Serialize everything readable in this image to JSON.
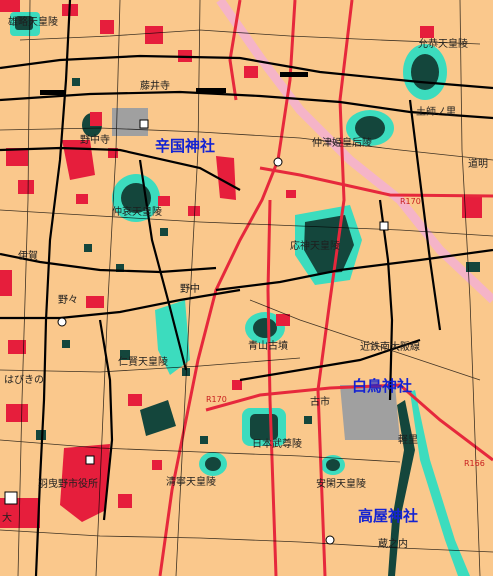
{
  "colors": {
    "land": "#fac88c",
    "road_red": "#e6283c",
    "road_black": "#000000",
    "block_red": "#e61e3c",
    "mound_green": "#14463c",
    "moat_cyan": "#3cdcbe",
    "grey_area": "#a0a0a0",
    "rail_pink": "#f5b4c8",
    "shrine_text": "#1423d2"
  },
  "shrines": [
    {
      "name": "辛国神社"
    },
    {
      "name": "白鳥神社"
    },
    {
      "name": "高屋神社"
    }
  ],
  "kofun": [
    {
      "name": "雄略天皇陵"
    },
    {
      "name": "允恭天皇陵"
    },
    {
      "name": "仲津姫皇后陵"
    },
    {
      "name": "仲哀天皇陵"
    },
    {
      "name": "応神天皇陵"
    },
    {
      "name": "野中寺"
    },
    {
      "name": "仁賢天皇陵"
    },
    {
      "name": "青山古墳"
    },
    {
      "name": "日本武尊陵"
    },
    {
      "name": "清寧天皇陵"
    },
    {
      "name": "安閑天皇陵"
    },
    {
      "name": "羽曳野市役所"
    }
  ],
  "places": [
    {
      "name": "藤井寺"
    },
    {
      "name": "土師ノ里"
    },
    {
      "name": "道明"
    },
    {
      "name": "伊賀"
    },
    {
      "name": "野々"
    },
    {
      "name": "野中"
    },
    {
      "name": "はびきの"
    },
    {
      "name": "古市"
    },
    {
      "name": "近鉄南大阪線"
    },
    {
      "name": "軽里"
    },
    {
      "name": "蔵之内"
    },
    {
      "name": "大"
    }
  ],
  "roads": [
    {
      "name": "R170"
    },
    {
      "name": "R166"
    }
  ]
}
